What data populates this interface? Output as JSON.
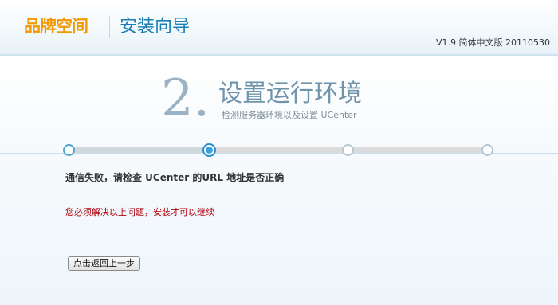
{
  "header": {
    "logo_text": "品牌空间",
    "wizard_title": "安装向导",
    "version": "V1.9 简体中文版 20110530"
  },
  "step": {
    "number": "2.",
    "title": "设置运行环境",
    "description": "检测服务器环境以及设置 UCenter",
    "current_index": 2,
    "total": 4
  },
  "messages": {
    "error": "通信失败，请检查 UCenter 的URL 地址是否正确",
    "warning": "您必须解决以上问题，安装才可以继续"
  },
  "buttons": {
    "back": "点击返回上一步"
  },
  "colors": {
    "brand_orange": "#f39800",
    "title_blue": "#1a7fb4",
    "warning_red": "#b0000d",
    "step_active": "#2a8fcf"
  }
}
